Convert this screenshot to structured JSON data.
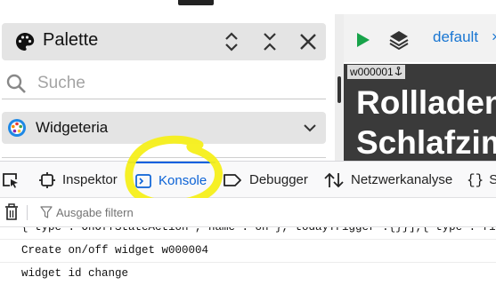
{
  "palette": {
    "title": "Palette",
    "search_placeholder": "Suche",
    "widget_group": "Widgeteria"
  },
  "view": {
    "tab_label": "default",
    "tab_close": "×",
    "widget_id": "w000001",
    "widget_text_line1": "Rollladen",
    "widget_text_line2": "Schlafzimmer"
  },
  "devtools": {
    "tabs": [
      {
        "label": "Inspektor",
        "icon": "inspector-icon"
      },
      {
        "label": "Konsole",
        "icon": "console-icon",
        "active": true
      },
      {
        "label": "Debugger",
        "icon": "debugger-icon"
      },
      {
        "label": "Netzwerkanalyse",
        "icon": "network-icon"
      },
      {
        "label": "S",
        "icon": "style-editor-icon"
      }
    ],
    "filter_placeholder": "Ausgabe filtern"
  },
  "console": {
    "lines": [
      "{\"type\":\"OnOffStateAction\",\"name\":\"on\"},\"todayTrigger\":{}}],{\"type\":\"fil",
      "Create on/off widget w000004",
      "widget id change"
    ]
  },
  "colors": {
    "accent_blue": "#0b62d6",
    "play_green": "#18a34a",
    "highlight_yellow": "#f5ef1a",
    "preview_bg": "#3a3a3a"
  }
}
